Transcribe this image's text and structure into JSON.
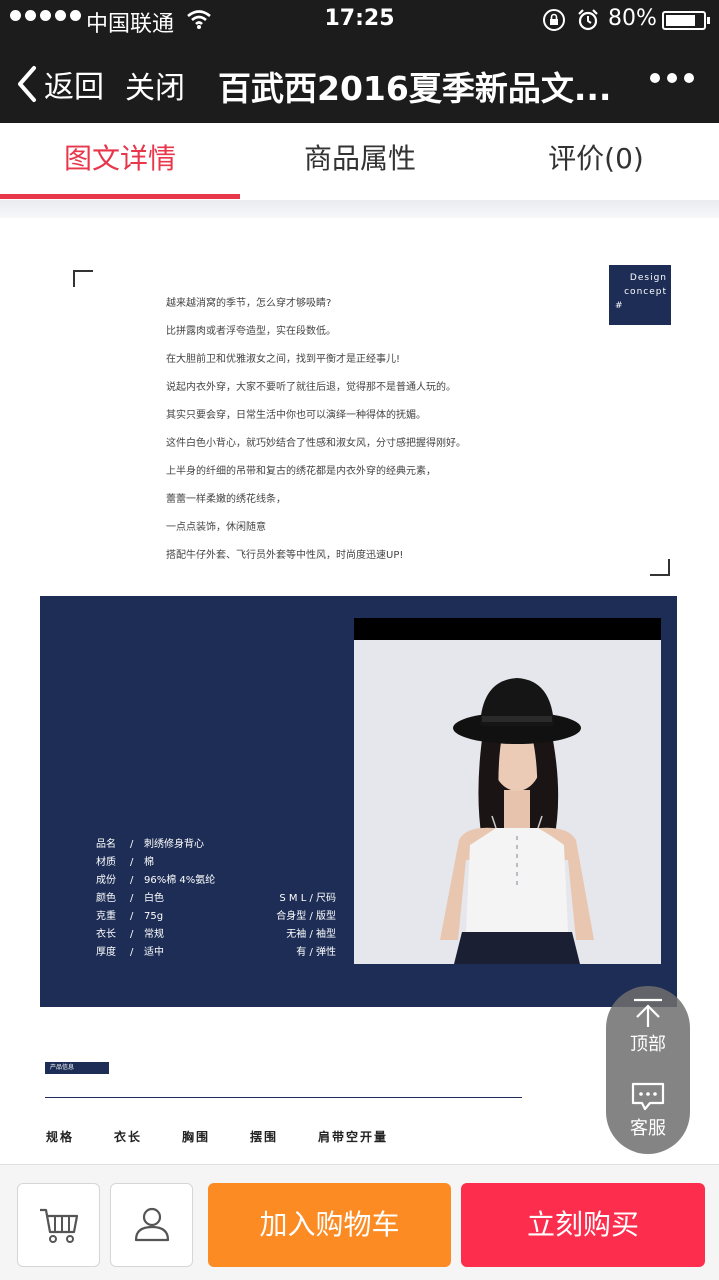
{
  "status_bar": {
    "carrier": "中国联通",
    "time": "17:25",
    "battery_percent_label": "80%",
    "battery_level": 0.8,
    "icons": [
      "signal-dots-icon",
      "wifi-icon",
      "rotation-lock-icon",
      "alarm-icon",
      "battery-icon"
    ]
  },
  "nav": {
    "back_label": "返回",
    "close_label": "关闭",
    "title": "百武西2016夏季新品文...",
    "more_icon": "more-dots-icon"
  },
  "tabs": [
    {
      "label": "图文详情",
      "active": true
    },
    {
      "label": "商品属性",
      "active": false
    },
    {
      "label": "评价(0)",
      "active": false
    }
  ],
  "design_box": {
    "line1": "Design",
    "line2": "concept",
    "line3": "#"
  },
  "description_lines": [
    "越来越消窝的季节，怎么穿才够吸睛?",
    "比拼露肉或者浮夸造型，实在段数低。",
    "在大胆前卫和优雅淑女之间，找到平衡才是正经事儿!",
    "说起内衣外穿，大家不要听了就往后退，觉得那不是普通人玩的。",
    "其实只要会穿，日常生活中你也可以演绎一种得体的抚媚。",
    "这件白色小背心，就巧妙结合了性感和淑女风，分寸感把握得刚好。",
    "上半身的纤细的吊带和复古的绣花都是内衣外穿的经典元素，",
    "蕾蕾一样柔嫩的绣花线条，",
    "一点点装饰，休闲随意",
    "搭配牛仔外套、飞行员外套等中性风，时尚度迅速UP!"
  ],
  "specs": [
    {
      "key": "品名",
      "value": "刺绣修身背心",
      "right": ""
    },
    {
      "key": "材质",
      "value": "棉",
      "right": ""
    },
    {
      "key": "成份",
      "value": "96%棉 4%氨纶",
      "right": ""
    },
    {
      "key": "颜色",
      "value": "白色",
      "right": "S M L  /  尺码"
    },
    {
      "key": "克重",
      "value": "75g",
      "right": "合身型  /  版型"
    },
    {
      "key": "衣长",
      "value": "常规",
      "right": "无袖  /  袖型"
    },
    {
      "key": "厚度",
      "value": "适中",
      "right": "有  /  弹性"
    }
  ],
  "info_tag": "产品信息",
  "size_headers": [
    "规格",
    "衣长",
    "胸围",
    "摆围",
    "肩带空开量"
  ],
  "float_buttons": {
    "top_label": "顶部",
    "service_label": "客服"
  },
  "bottom_bar": {
    "cart_icon": "shopping-cart-icon",
    "user_icon": "user-icon",
    "add_to_cart_label": "加入购物车",
    "buy_now_label": "立刻购买"
  },
  "colors": {
    "accent_red": "#e8364a",
    "navy": "#1d2d55",
    "orange": "#fb8b22",
    "buy_red": "#fd2d4d",
    "nav_bg": "#1c1c1c"
  }
}
